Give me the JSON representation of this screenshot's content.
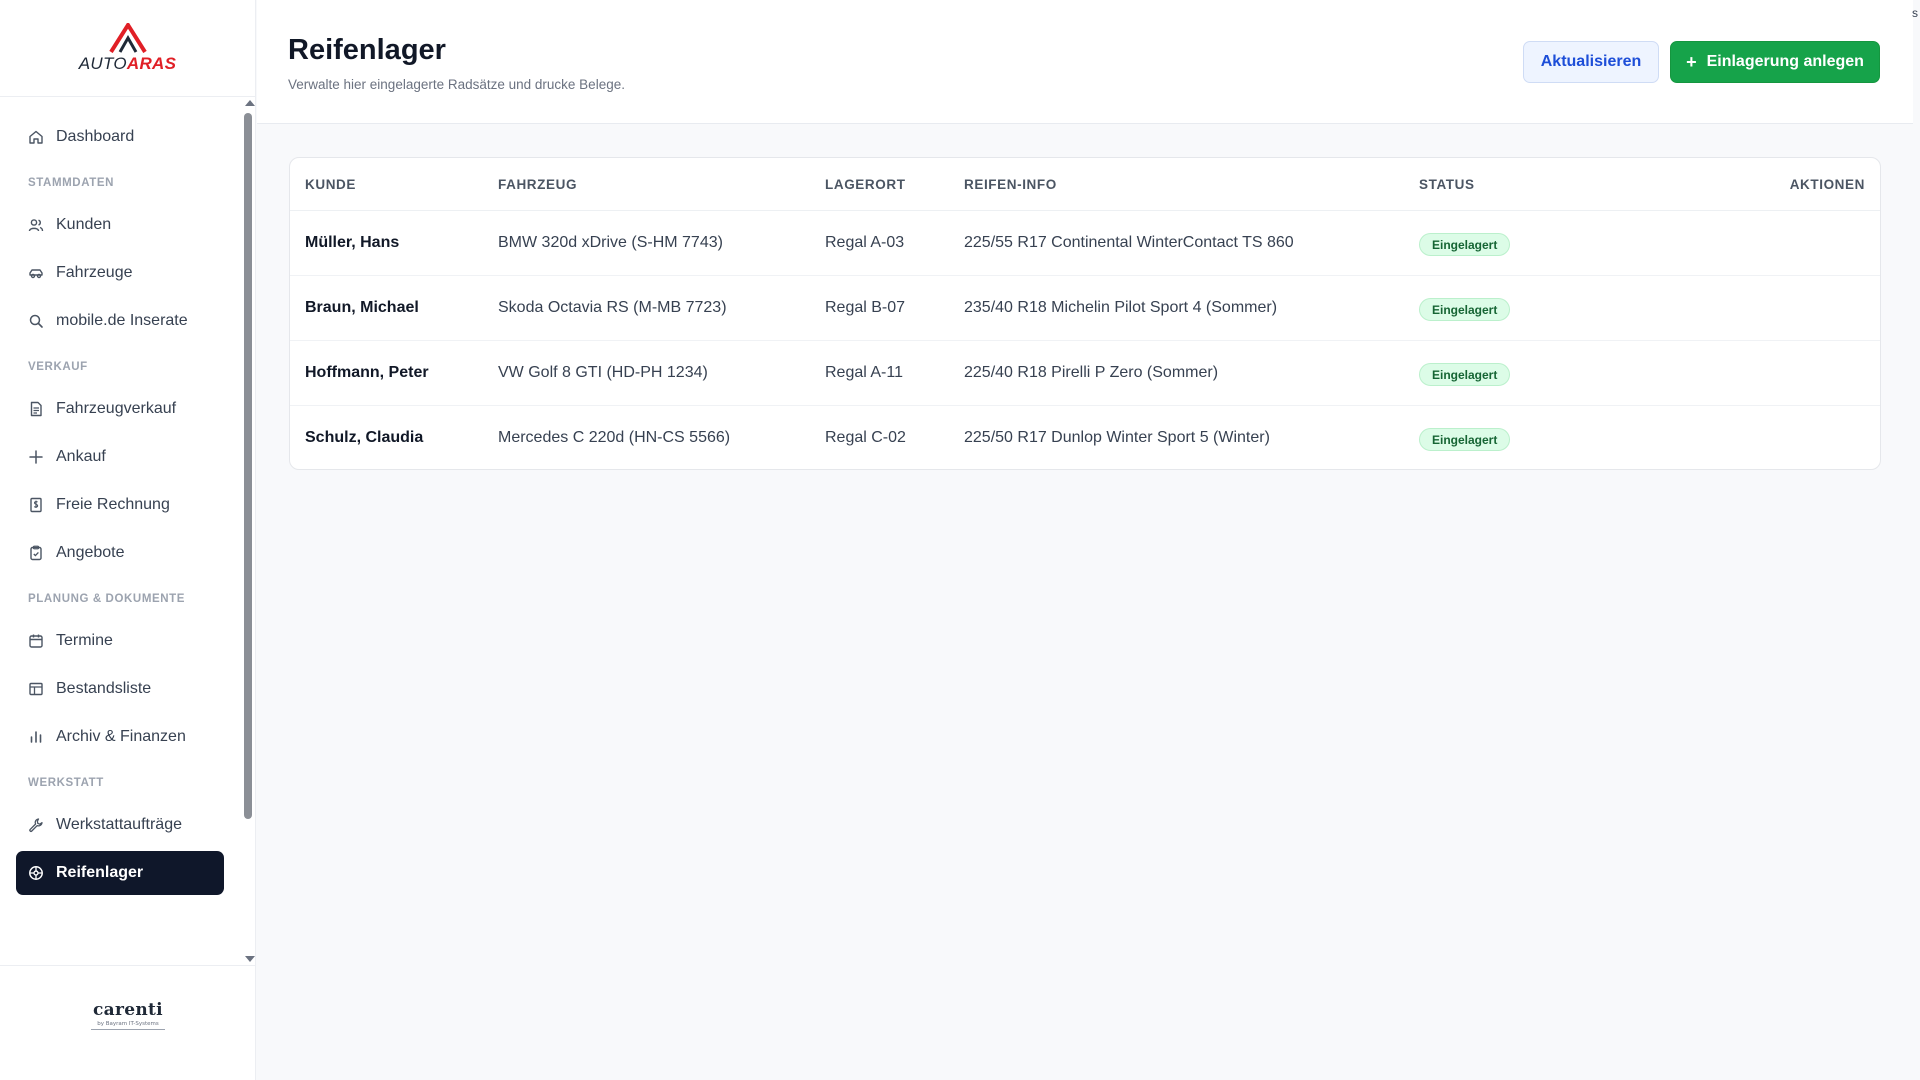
{
  "app": {
    "logo_auto": "AUTO",
    "logo_aras": "ARAS",
    "brand_name": "carenti",
    "brand_sub": "by Bayram IT-Systems",
    "corner_char": "s"
  },
  "sidebar": {
    "items": [
      {
        "type": "item",
        "label": "Dashboard",
        "icon": "home-icon"
      },
      {
        "type": "section",
        "label": "STAMMDATEN"
      },
      {
        "type": "item",
        "label": "Kunden",
        "icon": "users-icon"
      },
      {
        "type": "item",
        "label": "Fahrzeuge",
        "icon": "car-icon"
      },
      {
        "type": "item",
        "label": "mobile.de Inserate",
        "icon": "search-icon"
      },
      {
        "type": "section",
        "label": "VERKAUF"
      },
      {
        "type": "item",
        "label": "Fahrzeugverkauf",
        "icon": "document-icon"
      },
      {
        "type": "item",
        "label": "Ankauf",
        "icon": "plus-icon"
      },
      {
        "type": "item",
        "label": "Freie Rechnung",
        "icon": "invoice-icon"
      },
      {
        "type": "item",
        "label": "Angebote",
        "icon": "clipboard-icon"
      },
      {
        "type": "section",
        "label": "PLANUNG & DOKUMENTE"
      },
      {
        "type": "item",
        "label": "Termine",
        "icon": "calendar-icon"
      },
      {
        "type": "item",
        "label": "Bestandsliste",
        "icon": "table-icon"
      },
      {
        "type": "item",
        "label": "Archiv & Finanzen",
        "icon": "bar-chart-icon"
      },
      {
        "type": "section",
        "label": "WERKSTATT"
      },
      {
        "type": "item",
        "label": "Werkstattaufträge",
        "icon": "wrench-icon"
      },
      {
        "type": "item",
        "label": "Reifenlager",
        "icon": "tire-icon",
        "active": true
      }
    ]
  },
  "header": {
    "title": "Reifenlager",
    "subtitle": "Verwalte hier eingelagerte Radsätze und drucke Belege.",
    "refresh_label": "Aktualisieren",
    "add_label": "Einlagerung anlegen",
    "add_icon": "+"
  },
  "table": {
    "columns": [
      "KUNDE",
      "FAHRZEUG",
      "LAGERORT",
      "REIFEN-INFO",
      "STATUS",
      "AKTIONEN"
    ],
    "rows": [
      {
        "kunde": "Müller, Hans",
        "fahrzeug": "BMW 320d xDrive (S-HM 7743)",
        "lagerort": "Regal A-03",
        "reifen": "225/55 R17 Continental WinterContact TS 860",
        "status": "Eingelagert"
      },
      {
        "kunde": "Braun, Michael",
        "fahrzeug": "Skoda Octavia RS (M-MB 7723)",
        "lagerort": "Regal B-07",
        "reifen": "235/40 R18 Michelin Pilot Sport 4 (Sommer)",
        "status": "Eingelagert"
      },
      {
        "kunde": "Hoffmann, Peter",
        "fahrzeug": "VW Golf 8 GTI (HD-PH 1234)",
        "lagerort": "Regal A-11",
        "reifen": "225/40 R18 Pirelli P Zero (Sommer)",
        "status": "Eingelagert"
      },
      {
        "kunde": "Schulz, Claudia",
        "fahrzeug": "Mercedes C 220d (HN-CS 5566)",
        "lagerort": "Regal C-02",
        "reifen": "225/50 R17 Dunlop Winter Sport 5 (Winter)",
        "status": "Eingelagert"
      }
    ]
  },
  "colors": {
    "accent_primary": "#16a34a",
    "accent_secondary": "#1d4ed8",
    "nav_active_bg": "#0f172a",
    "status_bg": "#dcfce7",
    "status_text": "#166534",
    "logo_red": "#e01f26"
  }
}
